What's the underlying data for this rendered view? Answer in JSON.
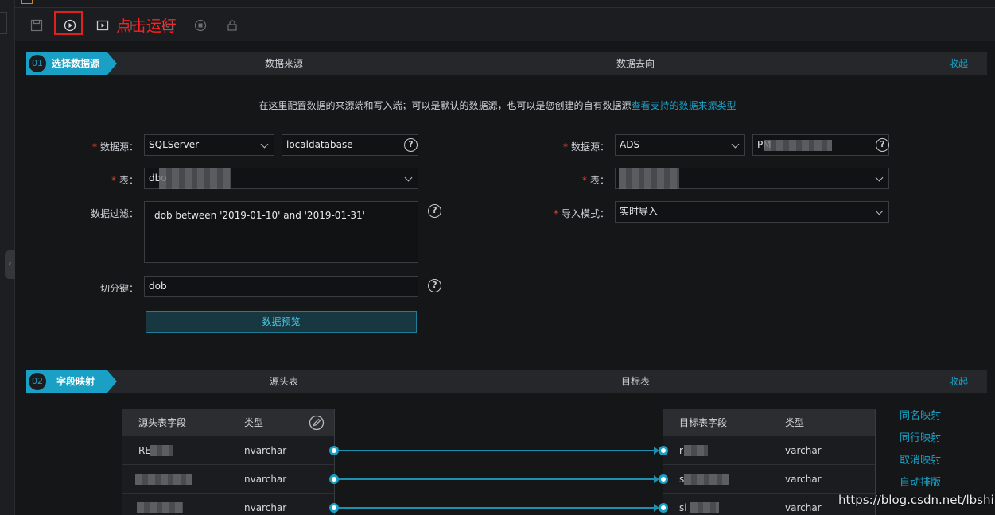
{
  "toolbar": {
    "icons": [
      "save-icon",
      "run-icon",
      "run-selected-icon",
      "format-icon",
      "params-icon",
      "stop-icon",
      "lock-icon"
    ],
    "annotation": "点击运行"
  },
  "section1": {
    "step": "01",
    "title": "选择数据源",
    "col_source": "数据来源",
    "col_target": "数据去向",
    "collapse": "收起"
  },
  "hint": {
    "text": "在这里配置数据的来源端和写入端；可以是默认的数据源，也可以是您创建的自有数据源",
    "link": "查看支持的数据来源类型"
  },
  "source": {
    "datasource_label": "数据源：",
    "datasource_type": "SQLServer",
    "datasource_name": "localdatabase",
    "table_label": "表：",
    "table_value": "dbo",
    "filter_label": "数据过滤：",
    "filter_value": "dob  between '2019-01-10' and '2019-01-31'",
    "split_label": "切分键：",
    "split_value": "dob",
    "preview_button": "数据预览"
  },
  "target": {
    "datasource_label": "数据源：",
    "datasource_type": "ADS",
    "datasource_name": "PM",
    "table_label": "表：",
    "table_value": "",
    "import_label": "导入模式：",
    "import_value": "实时导入"
  },
  "section2": {
    "step": "02",
    "title": "字段映射",
    "col_source": "源头表",
    "col_target": "目标表",
    "collapse": "收起"
  },
  "mapping": {
    "source_headers": [
      "源头表字段",
      "类型"
    ],
    "target_headers": [
      "目标表字段",
      "类型"
    ],
    "source_rows": [
      {
        "field": "RE",
        "type": "nvarchar"
      },
      {
        "field": "",
        "type": "nvarchar"
      },
      {
        "field": "",
        "type": "nvarchar"
      }
    ],
    "target_rows": [
      {
        "field": "r",
        "type": "varchar"
      },
      {
        "field": "s",
        "type": "varchar"
      },
      {
        "field": "si",
        "type": "varchar"
      }
    ],
    "actions": [
      "同名映射",
      "同行映射",
      "取消映射",
      "自动排版"
    ]
  },
  "watermark": "https://blog.csdn.net/lbship",
  "colors": {
    "accent": "#1aa0c4",
    "highlight": "#e0211d",
    "required": "#e5402d"
  }
}
